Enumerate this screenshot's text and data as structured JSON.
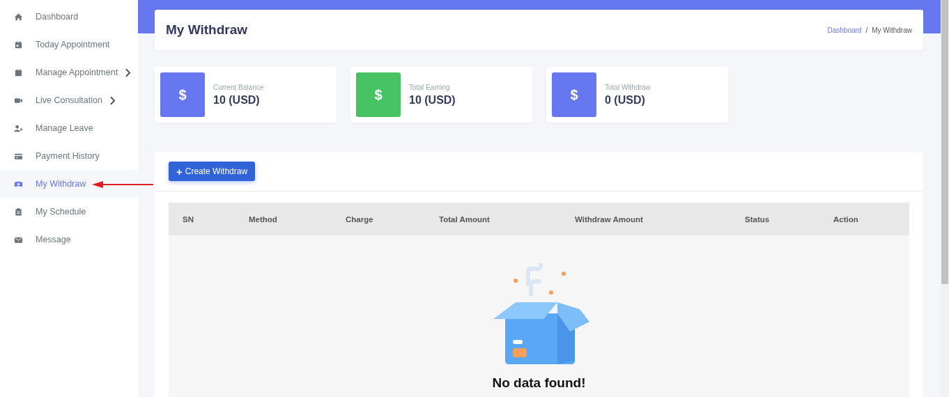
{
  "sidebar": {
    "items": [
      {
        "label": "Dashboard",
        "selected": false,
        "has_submenu": false
      },
      {
        "label": "Today Appointment",
        "selected": false,
        "has_submenu": false
      },
      {
        "label": "Manage Appointment",
        "selected": false,
        "has_submenu": true
      },
      {
        "label": "Live Consultation",
        "selected": false,
        "has_submenu": true
      },
      {
        "label": "Manage Leave",
        "selected": false,
        "has_submenu": false
      },
      {
        "label": "Payment History",
        "selected": false,
        "has_submenu": false
      },
      {
        "label": "My Withdraw",
        "selected": true,
        "has_submenu": false
      },
      {
        "label": "My Schedule",
        "selected": false,
        "has_submenu": false
      },
      {
        "label": "Message",
        "selected": false,
        "has_submenu": false
      }
    ]
  },
  "page_header": {
    "title": "My Withdraw",
    "breadcrumb": [
      {
        "label": "Dashboard",
        "kind": "link"
      },
      {
        "label": "/",
        "kind": "separator"
      },
      {
        "label": "My Withdraw",
        "kind": "current"
      }
    ]
  },
  "stats": [
    {
      "label": "Current Balance",
      "value": "10 (USD)",
      "icon": "$",
      "color": "#6777ef"
    },
    {
      "label": "Total Earning",
      "value": "10 (USD)",
      "icon": "$",
      "color": "#47c363"
    },
    {
      "label": "Total Withdraw",
      "value": "0 (USD)",
      "icon": "$",
      "color": "#6777ef"
    }
  ],
  "create_button": {
    "icon": "+",
    "label": "Create Withdraw"
  },
  "table": {
    "columns": [
      "SN",
      "Method",
      "Charge",
      "Total Amount",
      "Withdraw Amount",
      "Status",
      "Action"
    ],
    "empty_message": "No data found!"
  }
}
